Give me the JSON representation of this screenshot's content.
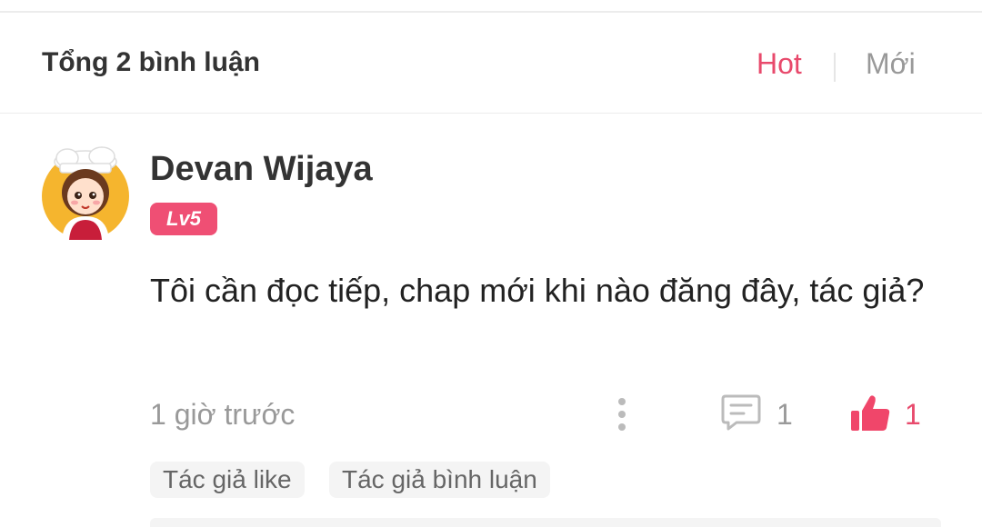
{
  "header": {
    "total_comments_label": "Tổng 2 bình luận",
    "sort_options": {
      "hot": "Hot",
      "new": "Mới"
    },
    "active_sort": "Hot"
  },
  "comment": {
    "username": "Devan Wijaya",
    "level": "Lv5",
    "text": "Tôi cần đọc tiếp, chap mới khi nào đăng đây, tác giả?",
    "timestamp": "1 giờ trước",
    "reply_count": "1",
    "like_count": "1",
    "tags": [
      "Tác giả like",
      "Tác giả bình luận"
    ]
  },
  "icons": {
    "more": "more-vertical-icon",
    "reply": "comment-icon",
    "like": "thumbs-up-icon"
  },
  "colors": {
    "accent": "#e84a6c",
    "level_badge": "#ef4f74",
    "muted_text": "#999999",
    "tag_bg": "#f4f4f4"
  }
}
